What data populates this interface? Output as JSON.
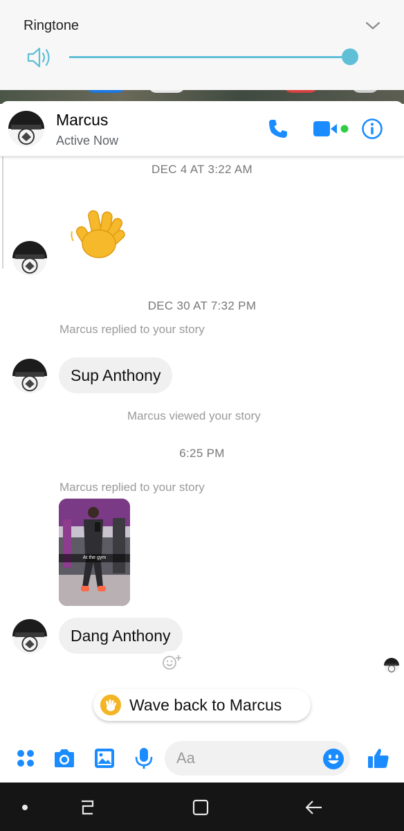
{
  "volume_panel": {
    "title": "Ringtone",
    "level": 1.0,
    "accent_color": "#5fbfd7",
    "icons": [
      "speaker-icon",
      "chevron-down-icon"
    ]
  },
  "header": {
    "contact_name": "Marcus",
    "status": "Active Now",
    "icons": [
      "phone-icon",
      "video-call-icon",
      "info-icon"
    ],
    "accent_color": "#1a8cff",
    "presence_color": "#31cc46"
  },
  "messages": {
    "timestamp_1": "DEC 4 AT 3:22 AM",
    "wave_emoji": "waving-hand-icon",
    "timestamp_2": "DEC 30 AT 7:32 PM",
    "note_replied_1": "Marcus replied to your story",
    "bubble_1": "Sup Anthony",
    "note_viewed": "Marcus viewed your story",
    "timestamp_3": "6:25 PM",
    "note_replied_2": "Marcus replied to your story",
    "story_caption": "At the gym",
    "bubble_2": "Dang Anthony"
  },
  "wave_back": {
    "label": "Wave back to Marcus",
    "icon": "waving-hand-icon"
  },
  "composer": {
    "placeholder": "Aa",
    "icons": [
      "more-apps-icon",
      "camera-icon",
      "gallery-icon",
      "microphone-icon",
      "emoji-icon",
      "thumbs-up-icon"
    ]
  },
  "navbar": {
    "icons": [
      "dot-icon",
      "recents-icon",
      "home-icon",
      "back-icon"
    ]
  }
}
